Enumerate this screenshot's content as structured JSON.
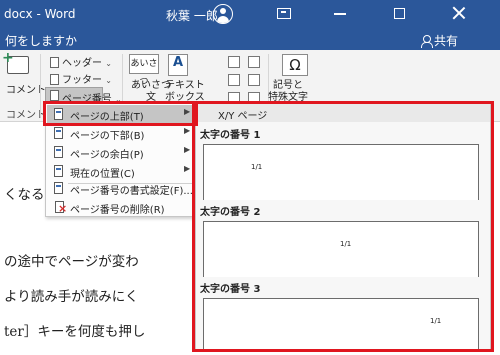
{
  "titlebar": {
    "doc_title": "docx  -  Word",
    "user_name": "秋葉 一郎"
  },
  "tellbar": {
    "tell_me": "何をしますか",
    "share": "共有"
  },
  "ribbon": {
    "comment_label": "コメント",
    "comment_group": "コメント",
    "header": "ヘッダー",
    "footer": "フッター",
    "page_number": "ページ番号",
    "greeting_label": "あいさつ\n文",
    "greeting_icon_text": "あいさつ",
    "textbox_label": "テキスト\nボックス",
    "symbol_label": "記号と\n特殊文字",
    "symbol_icon_text": "Ω",
    "caret": "⌄"
  },
  "document": {
    "lines": [
      "くなると、自動的に次",
      "の途中でページが変わ",
      "より読み手が読みにく",
      "ter］キーを何度も押し"
    ]
  },
  "menu": {
    "items": [
      {
        "label": "ページの上部(T)"
      },
      {
        "label": "ページの下部(B)"
      },
      {
        "label": "ページの余白(P)"
      },
      {
        "label": "現在の位置(C)"
      },
      {
        "label": "ページ番号の書式設定(F)..."
      },
      {
        "label": "ページ番号の削除(R)"
      }
    ],
    "arrow": "▶"
  },
  "gallery": {
    "header": "X/Y ページ",
    "styles": [
      {
        "label": "太字の番号 1",
        "number": "1/1"
      },
      {
        "label": "太字の番号 2",
        "number": "1/1"
      },
      {
        "label": "太字の番号 3",
        "number": "1/1"
      }
    ]
  },
  "colors": {
    "title_bar": "#2b579a",
    "highlight": "#e0161f",
    "menu_active": "#c5c5c5"
  }
}
